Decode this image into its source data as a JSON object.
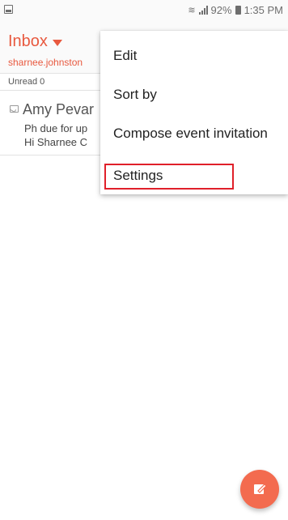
{
  "status_bar": {
    "battery": "92%",
    "time": "1:35 PM"
  },
  "header": {
    "title": "Inbox",
    "account": "sharnee.johnston"
  },
  "unread": {
    "label": "Unread 0"
  },
  "mail": {
    "sender": "Amy Pevar",
    "subject": "Ph due for up",
    "preview": "Hi Sharnee  C"
  },
  "menu": {
    "items": [
      "Edit",
      "Sort by",
      "Compose event invitation",
      "Settings"
    ]
  },
  "colors": {
    "accent": "#e8593f",
    "fab": "#f36b4f",
    "highlight": "#e0202a"
  },
  "icons": {
    "fab": "compose-icon",
    "mail": "mail-icon"
  }
}
